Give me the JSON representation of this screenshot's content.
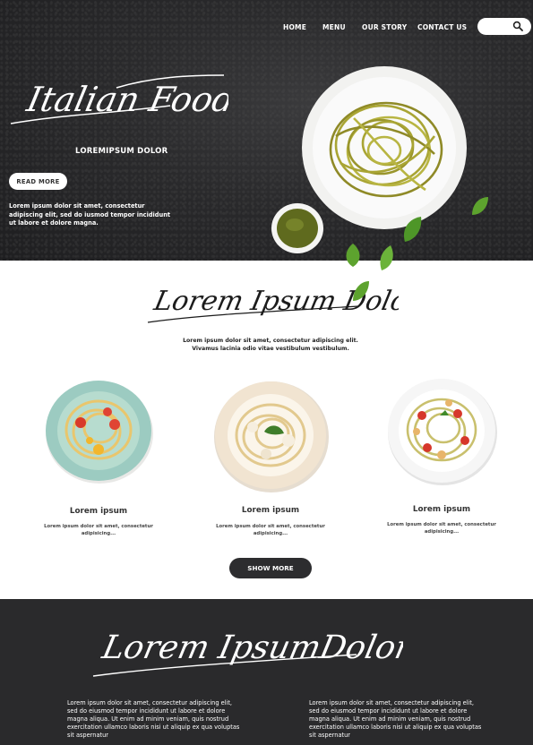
{
  "nav": {
    "items": [
      "HOME",
      "MENU",
      "OUR STORY",
      "CONTACT US"
    ],
    "search_icon": "search-icon"
  },
  "hero": {
    "script_title": "Italian Food",
    "subtitle": "LOREMIPSUM DOLOR",
    "read_more": "READ MORE",
    "text": "Lorem ipsum dolor sit amet, consectetur adipiscing elit, sed do iusmod tempor incididunt ut labore et dolore magna."
  },
  "intro": {
    "script_title": "Lorem Ipsum Dolor",
    "text": "Lorem ipsum dolor sit amet, consectetur adipiscing elit. Vivamus lacinia odio vitae vestibulum vestibulum."
  },
  "dishes": [
    {
      "title": "Lorem ipsum",
      "desc": "Lorem ipsum dolor sit amet, consectetur adipisicing..."
    },
    {
      "title": "Lorem ipsum",
      "desc": "Lorem ipsum dolor sit amet, consectetur adipisicing..."
    },
    {
      "title": "Lorem ipsum",
      "desc": "Lorem ipsum dolor sit amet, consectetur adipisicing..."
    }
  ],
  "show_more": "SHOW MORE",
  "footer": {
    "script_title": "Lorem IpsumDolor",
    "col_left": "Lorem ipsum dolor sit amet, consectetur adipiscing elit, sed do eiusmod tempor incididunt ut labore et dolore magna aliqua. Ut enim ad minim veniam, quis nostrud exercitation ullamco laboris nisi ut aliquip ex qua voluptas sit aspernatur",
    "col_right": "Lorem ipsum dolor sit amet, consectetur adipiscing elit, sed do eiusmod tempor incididunt ut labore et dolore magna aliqua. Ut enim ad minim veniam, quis nostrud exercitation ullamco laboris nisi ut aliquip ex qua voluptas sit aspernatur"
  },
  "colors": {
    "dark": "#2a2a2c",
    "pasta": "#a9a534",
    "leaf": "#5da32e",
    "button_dark": "#2d2d2f"
  }
}
